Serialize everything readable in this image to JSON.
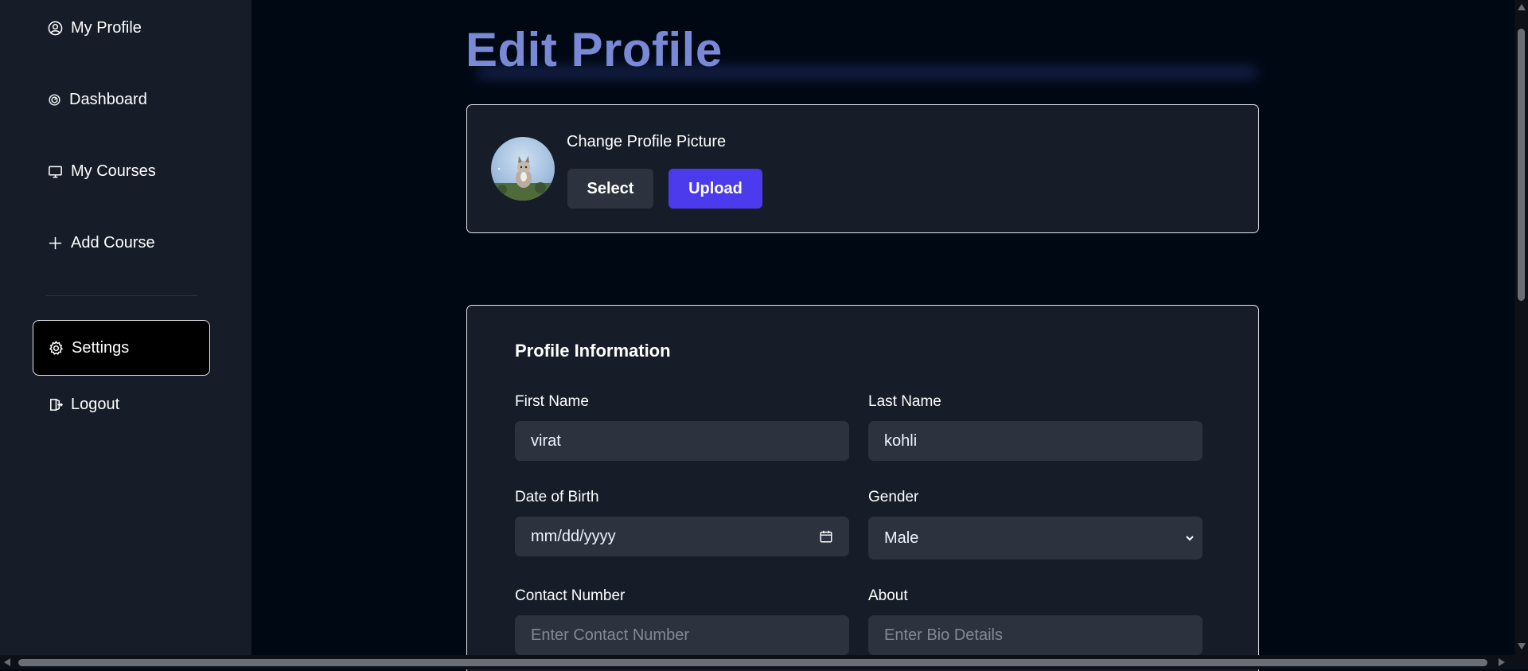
{
  "sidebar": {
    "items": [
      {
        "label": "My Profile",
        "icon": "user-circle-icon"
      },
      {
        "label": "Dashboard",
        "icon": "gauge-icon"
      },
      {
        "label": "My Courses",
        "icon": "monitor-icon"
      },
      {
        "label": "Add Course",
        "icon": "plus-icon"
      }
    ],
    "settings": {
      "label": "Settings",
      "icon": "gear-icon"
    },
    "logout": {
      "label": "Logout",
      "icon": "logout-icon"
    }
  },
  "page": {
    "title": "Edit Profile"
  },
  "picture": {
    "label": "Change Profile Picture",
    "select_label": "Select",
    "upload_label": "Upload"
  },
  "profile": {
    "section_title": "Profile Information",
    "first_name": {
      "label": "First Name",
      "value": "virat"
    },
    "last_name": {
      "label": "Last Name",
      "value": "kohli"
    },
    "dob": {
      "label": "Date of Birth",
      "value": "mm/dd/yyyy"
    },
    "gender": {
      "label": "Gender",
      "value": "Male"
    },
    "contact": {
      "label": "Contact Number",
      "placeholder": "Enter Contact Number"
    },
    "about": {
      "label": "About",
      "placeholder": "Enter Bio Details"
    }
  },
  "colors": {
    "background": "#000814",
    "sidebar": "#161d29",
    "card": "#161d29",
    "input": "#2c333f",
    "title": "#7a89d6",
    "upload_button": "#4c3aed"
  }
}
